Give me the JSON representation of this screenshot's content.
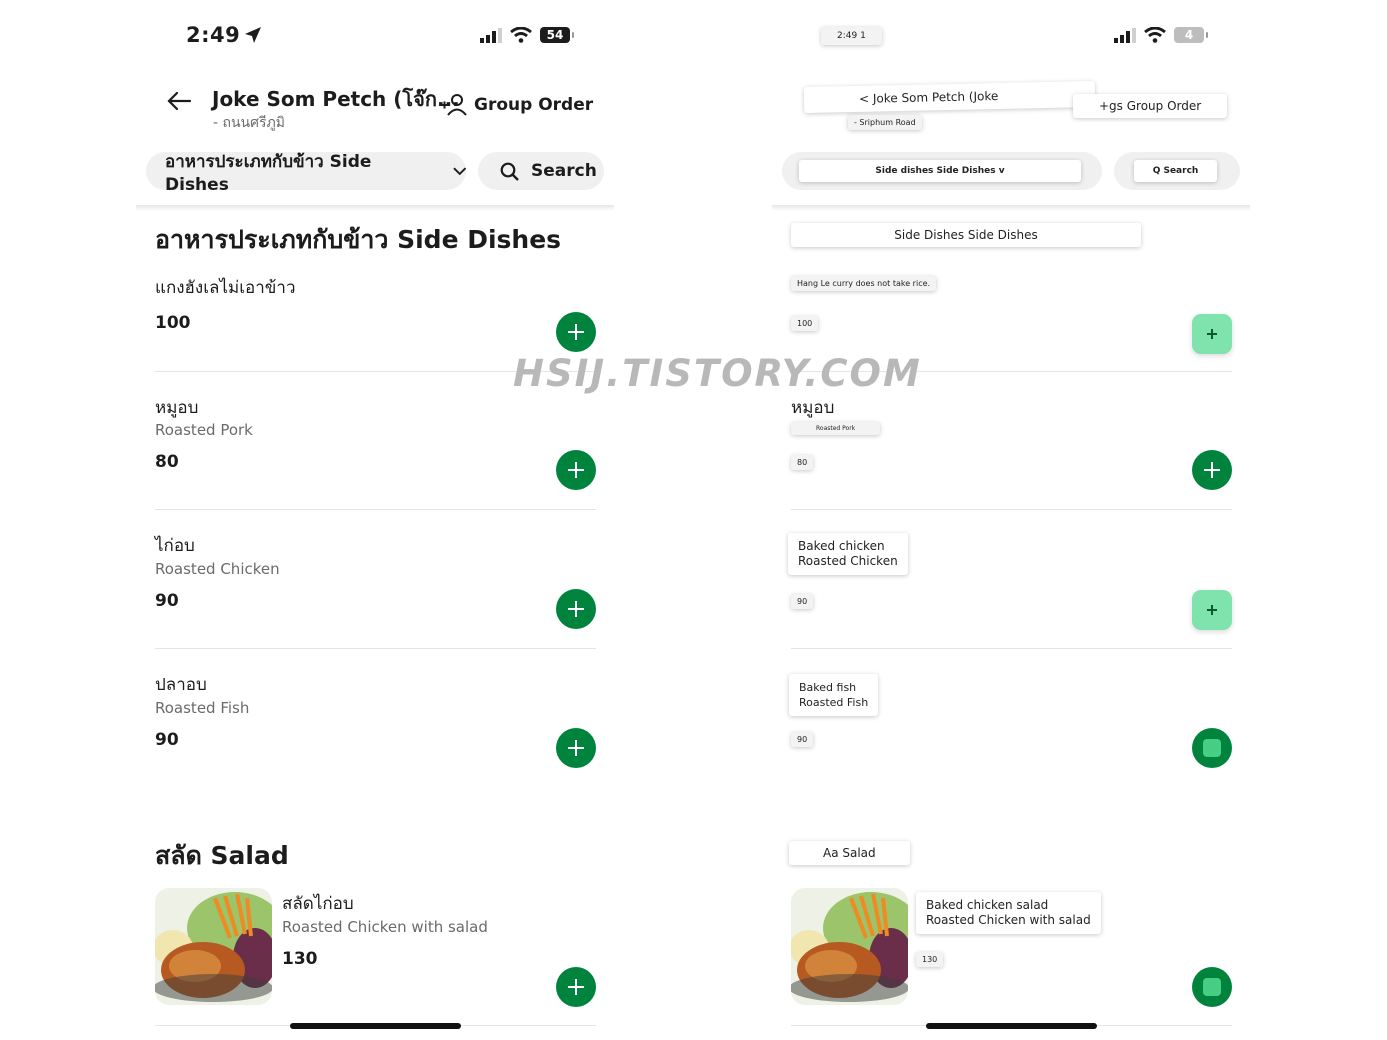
{
  "left": {
    "status_time": "2:49",
    "battery": "54",
    "restaurant_name": "Joke Som Petch (โจ๊ก...",
    "restaurant_sub": "- ถนนศรีภูมิ",
    "group_order": "Group Order",
    "category_select": "อาหารประเภทกับข้าว Side Dishes",
    "search": "Search",
    "section_side_dishes": "อาหารประเภทกับข้าว Side Dishes",
    "items": [
      {
        "name": "แกงฮังเลไม่เอาข้าว",
        "sub": "",
        "price": "100"
      },
      {
        "name": "หมูอบ",
        "sub": "Roasted Pork",
        "price": "80"
      },
      {
        "name": "ไก่อบ",
        "sub": "Roasted Chicken",
        "price": "90"
      },
      {
        "name": "ปลาอบ",
        "sub": "Roasted Fish",
        "price": "90"
      }
    ],
    "section_salad": "สลัด Salad",
    "salad_item": {
      "name": "สลัดไก่อบ",
      "sub": "Roasted Chicken with salad",
      "price": "130"
    }
  },
  "right": {
    "status_time": "2:49 1",
    "battery": "4",
    "restaurant_name": "< Joke Som Petch (Joke",
    "restaurant_sub": "- Sriphum Road",
    "group_order": "+gs Group Order",
    "category_select": "Side dishes Side Dishes v",
    "search": "Q Search",
    "section_side_dishes": "Side Dishes Side Dishes",
    "items": [
      {
        "name": "Hang Le curry does not take rice.",
        "price": "100"
      },
      {
        "name": "หมูอบ",
        "sub": "Roasted Pork",
        "price": "80"
      },
      {
        "name": "Baked chicken",
        "sub": "Roasted Chicken",
        "price": "90"
      },
      {
        "name": "Baked fish",
        "sub": "Roasted Fish",
        "price": "90"
      }
    ],
    "section_salad": "Aa Salad",
    "salad_item": {
      "name": "Baked chicken salad",
      "sub": "Roasted Chicken with salad",
      "price": "130"
    }
  },
  "watermark": "HSIJ.TISTORY.COM",
  "colors": {
    "brand_green": "#00843d",
    "mint_green": "#7ee3ac"
  }
}
